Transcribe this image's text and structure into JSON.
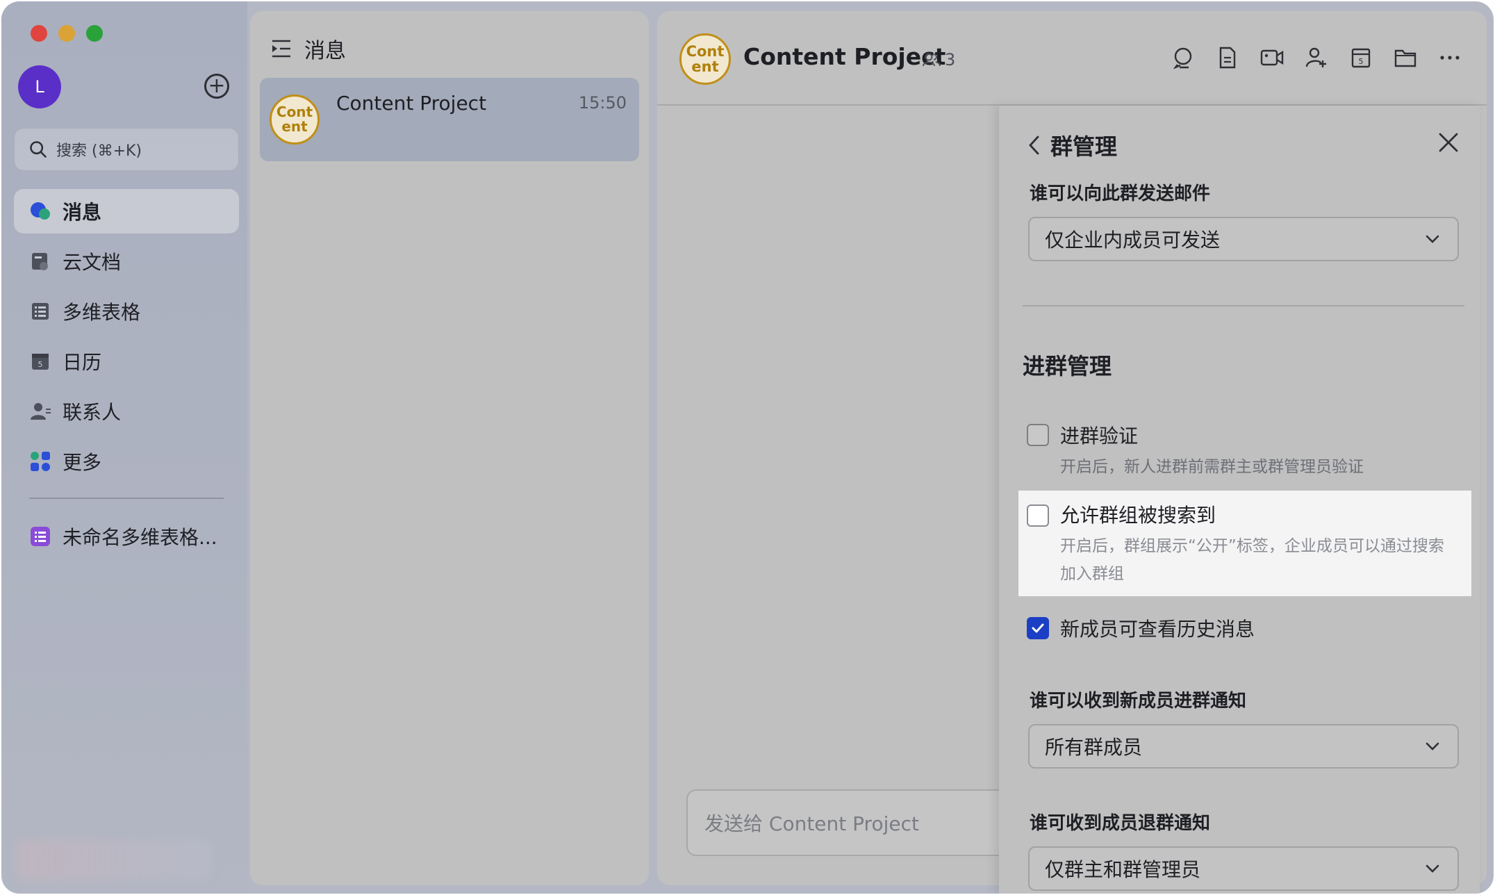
{
  "sidebar": {
    "avatar_letter": "L",
    "search_placeholder": "搜索 (⌘+K)",
    "items": [
      {
        "label": "消息",
        "icon": "message-bubble-icon",
        "active": true
      },
      {
        "label": "云文档",
        "icon": "cloud-doc-icon"
      },
      {
        "label": "多维表格",
        "icon": "table-icon"
      },
      {
        "label": "日历",
        "icon": "calendar-icon"
      },
      {
        "label": "联系人",
        "icon": "contacts-icon"
      },
      {
        "label": "更多",
        "icon": "apps-grid-icon"
      }
    ],
    "pinned": {
      "label": "未命名多维表格...",
      "icon": "table-purple-icon"
    }
  },
  "list": {
    "header": "消息",
    "conversations": [
      {
        "logo": "Cont\nent",
        "title": "Content Project",
        "time": "15:50"
      }
    ]
  },
  "chat": {
    "logo": "Cont\nent",
    "title": "Content Project",
    "member_count": "3",
    "composer_placeholder": "发送给 Content Project",
    "toolbar_icons": [
      "search-chat-icon",
      "doc-icon",
      "video-call-icon",
      "add-member-icon",
      "calendar-icon",
      "folder-icon",
      "more-icon"
    ]
  },
  "drawer": {
    "title": "群管理",
    "email_label": "谁可以向此群发送邮件",
    "email_value": "仅企业内成员可发送",
    "section_title": "进群管理",
    "options": [
      {
        "title": "进群验证",
        "desc": "开启后，新人进群前需群主或群管理员验证",
        "checked": false
      },
      {
        "title": "允许群组被搜索到",
        "desc": "开启后，群组展示“公开”标签，企业成员可以通过搜索加入群组",
        "checked": false
      },
      {
        "title": "新成员可查看历史消息",
        "desc": "",
        "checked": true
      }
    ],
    "join_notice_label": "谁可以收到新成员进群通知",
    "join_notice_value": "所有群成员",
    "leave_notice_label": "谁可收到成员退群通知",
    "leave_notice_value": "仅群主和群管理员"
  },
  "colors": {
    "accent": "#1b3fc4",
    "logo_gold": "#c08f17",
    "avatar": "#5a2fc8"
  }
}
